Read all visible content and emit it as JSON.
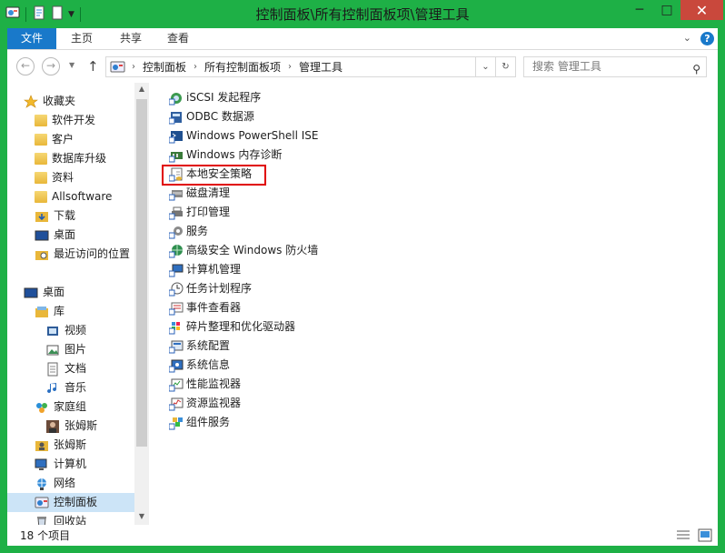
{
  "window": {
    "title": "控制面板\\所有控制面板项\\管理工具",
    "minimize": "─",
    "maximize": "□",
    "close": "✕"
  },
  "ribbon": {
    "tabs": [
      "文件",
      "主页",
      "共享",
      "查看"
    ]
  },
  "address": {
    "breadcrumbs": [
      "控制面板",
      "所有控制面板项",
      "管理工具"
    ],
    "search_placeholder": "搜索 管理工具"
  },
  "nav": {
    "favorites_label": "收藏夹",
    "favorites": [
      "软件开发",
      "客户",
      "数据库升级",
      "资料",
      "Allsoftware",
      "下载",
      "桌面",
      "最近访问的位置"
    ],
    "desktop_label": "桌面",
    "tree": [
      {
        "label": "库",
        "level": 1
      },
      {
        "label": "视频",
        "level": 2
      },
      {
        "label": "图片",
        "level": 2
      },
      {
        "label": "文档",
        "level": 2
      },
      {
        "label": "音乐",
        "level": 2
      },
      {
        "label": "家庭组",
        "level": 1
      },
      {
        "label": "张姆斯",
        "level": 2
      },
      {
        "label": "张姆斯",
        "level": 1
      },
      {
        "label": "计算机",
        "level": 1
      },
      {
        "label": "网络",
        "level": 1
      },
      {
        "label": "控制面板",
        "level": 1,
        "selected": true
      },
      {
        "label": "回收站",
        "level": 1
      }
    ]
  },
  "items": [
    "iSCSI 发起程序",
    "ODBC 数据源",
    "Windows PowerShell ISE",
    "Windows 内存诊断",
    "本地安全策略",
    "磁盘清理",
    "打印管理",
    "服务",
    "高级安全 Windows 防火墙",
    "计算机管理",
    "任务计划程序",
    "事件查看器",
    "碎片整理和优化驱动器",
    "系统配置",
    "系统信息",
    "性能监视器",
    "资源监视器",
    "组件服务"
  ],
  "highlighted_item": "本地安全策略",
  "status": {
    "count": "18 个项目"
  },
  "colors": {
    "frame": "#1eb046",
    "file_tab": "#1979ca",
    "highlight_box": "#e00000",
    "selected_nav": "#cce4f7"
  }
}
